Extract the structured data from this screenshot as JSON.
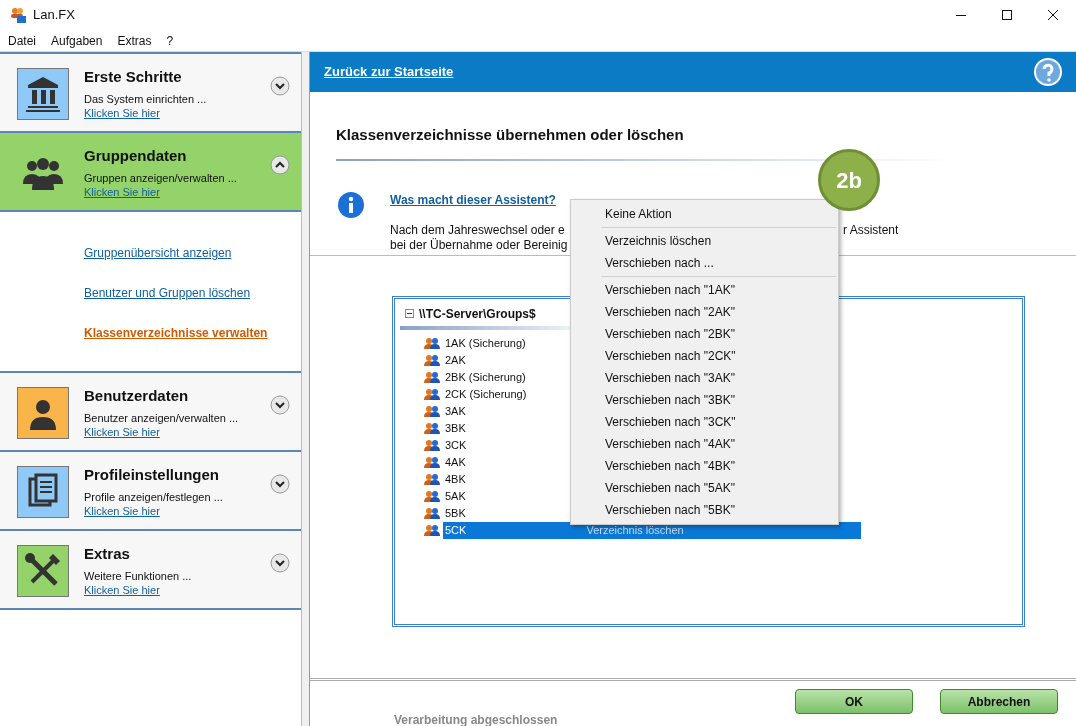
{
  "window": {
    "title": "Lan.FX"
  },
  "menu_bar": [
    "Datei",
    "Aufgaben",
    "Extras",
    "?"
  ],
  "sidebar": {
    "sections": [
      {
        "title": "Erste Schritte",
        "subtitle": "Das System einrichten ...",
        "link": "Klicken Sie hier",
        "color": "#8ec9f7",
        "selected": false,
        "expanded": false
      },
      {
        "title": "Gruppendaten",
        "subtitle": "Gruppen anzeigen/verwalten ...",
        "link": "Klicken Sie hier",
        "color": "#94d36a",
        "selected": true,
        "expanded": true,
        "children": [
          {
            "label": "Gruppenübersicht anzeigen",
            "selected": false
          },
          {
            "label": "Benutzer und Gruppen löschen",
            "selected": false
          },
          {
            "label": "Klassenverzeichnisse verwalten",
            "selected": true
          }
        ]
      },
      {
        "title": "Benutzerdaten",
        "subtitle": "Benutzer anzeigen/verwalten ...",
        "link": "Klicken Sie hier",
        "color": "#f9b54a",
        "selected": false,
        "expanded": false
      },
      {
        "title": "Profileinstellungen",
        "subtitle": "Profile anzeigen/festlegen ...",
        "link": "Klicken Sie hier",
        "color": "#8ec9f7",
        "selected": false,
        "expanded": false
      },
      {
        "title": "Extras",
        "subtitle": "Weitere Funktionen ...",
        "link": "Klicken Sie hier",
        "color": "#94d36a",
        "selected": false,
        "expanded": false
      }
    ]
  },
  "header": {
    "back_link": "Zurück zur Startseite"
  },
  "page_title": "Klassenverzeichnisse übernehmen oder löschen",
  "info": {
    "link": "Was macht dieser Assistent?",
    "line_1_start": "Nach dem Jahreswechsel oder e",
    "line_1_end": "r Assistent",
    "line_2_start": "bei der Übernahme oder Bereinig"
  },
  "tree": {
    "root": "\\\\TC-Server\\Groups$",
    "expanded": true,
    "items": [
      {
        "label": "1AK (Sicherung)",
        "selected": false
      },
      {
        "label": "2AK",
        "selected": false
      },
      {
        "label": "2BK (Sicherung)",
        "selected": false
      },
      {
        "label": "2CK (Sicherung)",
        "selected": false
      },
      {
        "label": "3AK",
        "selected": false
      },
      {
        "label": "3BK",
        "selected": false
      },
      {
        "label": "3CK",
        "selected": false
      },
      {
        "label": "4AK",
        "selected": false
      },
      {
        "label": "4BK",
        "selected": false
      },
      {
        "label": "5AK",
        "selected": false
      },
      {
        "label": "5BK",
        "selected": false
      },
      {
        "label": "5CK",
        "selected": true,
        "action": "Verzeichnis löschen"
      }
    ]
  },
  "context_menu": [
    {
      "kind": "item",
      "label": "Keine Aktion"
    },
    {
      "kind": "separator"
    },
    {
      "kind": "item",
      "label": "Verzeichnis löschen"
    },
    {
      "kind": "item",
      "label": "Verschieben nach ..."
    },
    {
      "kind": "separator"
    },
    {
      "kind": "item",
      "label": "Verschieben nach \"1AK\""
    },
    {
      "kind": "item",
      "label": "Verschieben nach \"2AK\""
    },
    {
      "kind": "item",
      "label": "Verschieben nach \"2BK\""
    },
    {
      "kind": "item",
      "label": "Verschieben nach \"2CK\""
    },
    {
      "kind": "item",
      "label": "Verschieben nach \"3AK\""
    },
    {
      "kind": "item",
      "label": "Verschieben nach \"3BK\""
    },
    {
      "kind": "item",
      "label": "Verschieben nach \"3CK\""
    },
    {
      "kind": "item",
      "label": "Verschieben nach \"4AK\""
    },
    {
      "kind": "item",
      "label": "Verschieben nach \"4BK\""
    },
    {
      "kind": "item",
      "label": "Verschieben nach \"5AK\""
    },
    {
      "kind": "item",
      "label": "Verschieben nach \"5BK\""
    }
  ],
  "step_badge": "2b",
  "buttons": [
    "OK",
    "Abbrechen"
  ],
  "status": "Verarbeitung abgeschlossen"
}
